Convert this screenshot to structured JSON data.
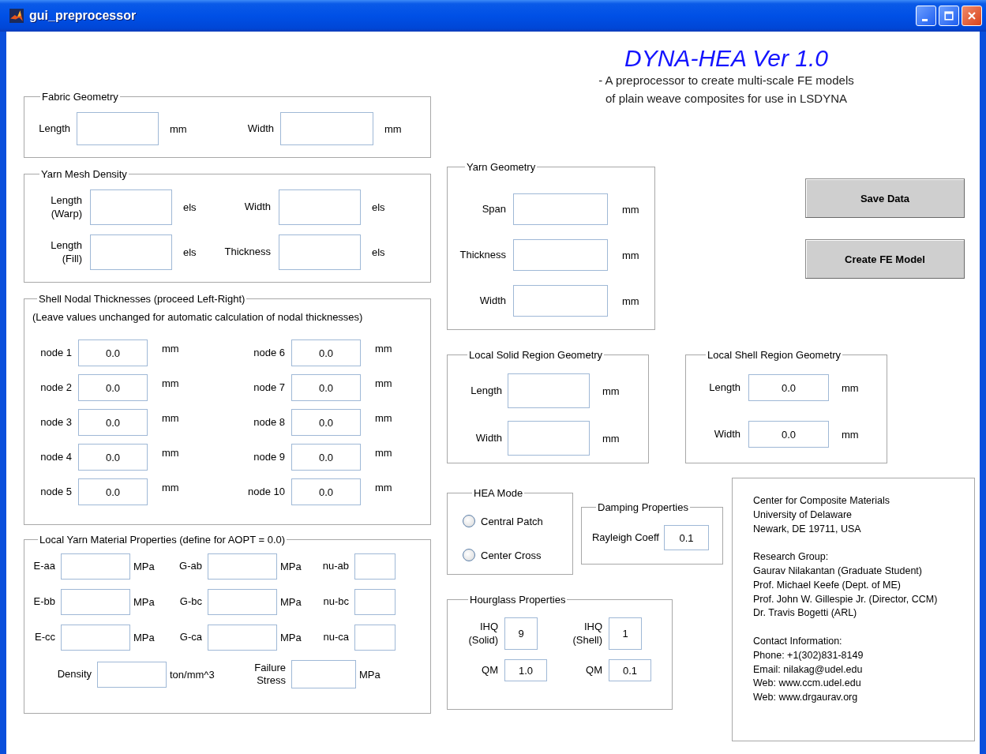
{
  "window": {
    "title": "gui_preprocessor"
  },
  "header": {
    "title": "DYNA-HEA Ver 1.0",
    "subtitle_lines": [
      "- A preprocessor to create multi-scale FE models",
      "of plain weave composites for use in LSDYNA"
    ]
  },
  "fabric_geometry": {
    "title": "Fabric Geometry",
    "rows": [
      [
        {
          "label": "Length",
          "unit": "mm"
        },
        {
          "label": "Width",
          "unit": "mm"
        }
      ]
    ]
  },
  "yarn_mesh_density": {
    "title": "Yarn Mesh Density",
    "rows": [
      [
        {
          "label": "Length\n(Warp)",
          "unit": "els"
        },
        {
          "label": "Width",
          "unit": "els"
        }
      ],
      [
        {
          "label": "Length\n(Fill)",
          "unit": "els"
        },
        {
          "label": "Thickness",
          "unit": "els"
        }
      ]
    ]
  },
  "shell_nodal_thicknesses": {
    "title": "Shell Nodal Thicknesses (proceed Left-Right)",
    "note": "(Leave values unchanged for automatic calculation of nodal thicknesses)",
    "rows": [
      [
        {
          "label": "node 1",
          "value": "0.0",
          "unit": "mm"
        },
        {
          "label": "node 6",
          "value": "0.0",
          "unit": "mm"
        }
      ],
      [
        {
          "label": "node 2",
          "value": "0.0",
          "unit": "mm"
        },
        {
          "label": "node 7",
          "value": "0.0",
          "unit": "mm"
        }
      ],
      [
        {
          "label": "node 3",
          "value": "0.0",
          "unit": "mm"
        },
        {
          "label": "node 8",
          "value": "0.0",
          "unit": "mm"
        }
      ],
      [
        {
          "label": "node 4",
          "value": "0.0",
          "unit": "mm"
        },
        {
          "label": "node 9",
          "value": "0.0",
          "unit": "mm"
        }
      ],
      [
        {
          "label": "node 5",
          "value": "0.0",
          "unit": "mm"
        },
        {
          "label": "node 10",
          "value": "0.0",
          "unit": "mm"
        }
      ]
    ]
  },
  "local_yarn_material": {
    "title": "Local Yarn Material Properties (define for AOPT = 0.0)",
    "rows": [
      [
        {
          "label": "E-aa",
          "unit": "MPa"
        },
        {
          "label": "G-ab",
          "unit": "MPa"
        },
        {
          "label": "nu-ab"
        }
      ],
      [
        {
          "label": "E-bb",
          "unit": "MPa"
        },
        {
          "label": "G-bc",
          "unit": "MPa"
        },
        {
          "label": "nu-bc"
        }
      ],
      [
        {
          "label": "E-cc",
          "unit": "MPa"
        },
        {
          "label": "G-ca",
          "unit": "MPa"
        },
        {
          "label": "nu-ca"
        }
      ]
    ],
    "extra_row": [
      {
        "label": "Density",
        "unit": "ton/mm^3"
      },
      {
        "label": "Failure\nStress",
        "unit": "MPa"
      }
    ]
  },
  "yarn_geometry": {
    "title": "Yarn Geometry",
    "rows": [
      [
        {
          "label": "Span",
          "unit": "mm"
        }
      ],
      [
        {
          "label": "Thickness",
          "unit": "mm"
        }
      ],
      [
        {
          "label": "Width",
          "unit": "mm"
        }
      ]
    ]
  },
  "buttons": [
    {
      "label": "Save Data"
    },
    {
      "label": "Create FE Model"
    }
  ],
  "local_solid_region": {
    "title": "Local Solid Region Geometry",
    "rows": [
      [
        {
          "label": "Length",
          "unit": "mm"
        }
      ],
      [
        {
          "label": "Width",
          "unit": "mm"
        }
      ]
    ]
  },
  "local_shell_region": {
    "title": "Local Shell Region Geometry",
    "rows": [
      [
        {
          "label": "Length",
          "value": "0.0",
          "unit": "mm"
        }
      ],
      [
        {
          "label": "Width",
          "value": "0.0",
          "unit": "mm"
        }
      ]
    ]
  },
  "hea_mode": {
    "title": "HEA Mode",
    "options": [
      {
        "label": "Central Patch",
        "selected": false
      },
      {
        "label": "Center Cross",
        "selected": false
      }
    ]
  },
  "damping": {
    "title": "Damping Properties",
    "rows": [
      [
        {
          "label": "Rayleigh Coeff",
          "value": "0.1"
        }
      ]
    ]
  },
  "hourglass": {
    "title": "Hourglass Properties",
    "rows": [
      [
        {
          "label": "IHQ\n(Solid)",
          "value": "9"
        },
        {
          "label": "IHQ\n(Shell)",
          "value": "1"
        }
      ],
      [
        {
          "label": "QM",
          "value": "1.0"
        },
        {
          "label": "QM",
          "value": "0.1"
        }
      ]
    ]
  },
  "info": {
    "paragraphs": [
      [
        "Center for Composite Materials",
        "University of Delaware",
        "Newark, DE 19711, USA"
      ],
      [
        "Research Group:",
        "Gaurav Nilakantan (Graduate Student)",
        "Prof. Michael Keefe (Dept. of ME)",
        "Prof. John W. Gillespie Jr. (Director, CCM)",
        "Dr. Travis Bogetti (ARL)"
      ],
      [
        "Contact Information:",
        "Phone: +1(302)831-8149",
        "Email: nilakag@udel.edu",
        "Web: www.ccm.udel.edu",
        "Web: www.drgaurav.org"
      ]
    ]
  }
}
